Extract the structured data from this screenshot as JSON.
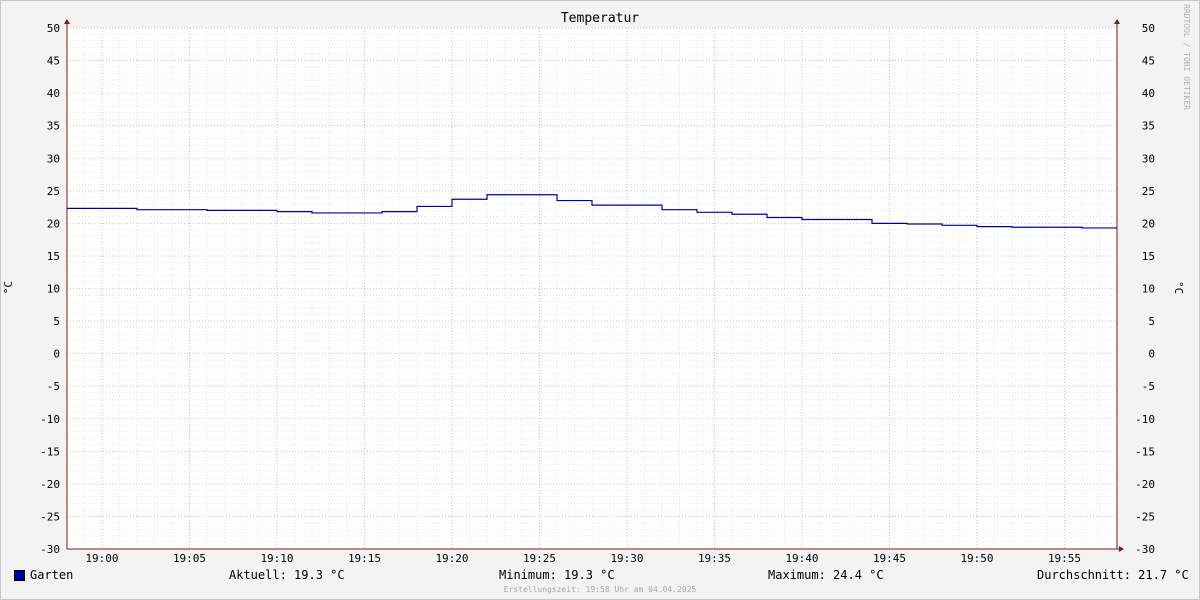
{
  "chart_data": {
    "type": "line",
    "title": "Temperatur",
    "ylabel": "°C",
    "ylim": [
      -30,
      50
    ],
    "y_ticks": [
      "50",
      "45",
      "40",
      "35",
      "30",
      "25",
      "20",
      "15",
      "10",
      "5",
      "0",
      "-5",
      "-10",
      "-15",
      "-20",
      "-25",
      "-30"
    ],
    "x_ticks": [
      "19:00",
      "19:05",
      "19:10",
      "19:15",
      "19:20",
      "19:25",
      "19:30",
      "19:35",
      "19:40",
      "19:45",
      "19:50",
      "19:55"
    ],
    "x_range": [
      "18:58",
      "19:58"
    ],
    "grid": true,
    "legend": "bottom-left",
    "series": [
      {
        "name": "Garten",
        "color": "#00009c",
        "step": true,
        "x": [
          "18:58",
          "19:02",
          "19:06",
          "19:10",
          "19:12",
          "19:16",
          "19:18",
          "19:20",
          "19:22",
          "19:26",
          "19:28",
          "19:32",
          "19:34",
          "19:36",
          "19:38",
          "19:40",
          "19:44",
          "19:46",
          "19:48",
          "19:50",
          "19:52",
          "19:56"
        ],
        "y": [
          22.3,
          22.1,
          22.0,
          21.8,
          21.6,
          21.8,
          22.6,
          23.7,
          24.4,
          23.5,
          22.8,
          22.1,
          21.7,
          21.4,
          20.9,
          20.6,
          20.0,
          19.9,
          19.7,
          19.5,
          19.4,
          19.3
        ]
      }
    ]
  },
  "legend": {
    "name": "Garten",
    "current": "Aktuell: 19.3 °C",
    "minimum": "Minimum: 19.3 °C",
    "maximum": "Maximum: 24.4 °C",
    "average": "Durchschnitt: 21.7 °C"
  },
  "watermark": "RRDTOOL / TOBI OETIKER",
  "footer": "Erstellungszeit: 19:58 Uhr am 04.04.2025",
  "colors": {
    "background": "#f3f3f3",
    "plot_background": "#ffffff",
    "minor_grid": "#d6d6d6",
    "major_grid": "#e8a8a8",
    "axis": "#7a1a1a",
    "series": "#00009c"
  }
}
